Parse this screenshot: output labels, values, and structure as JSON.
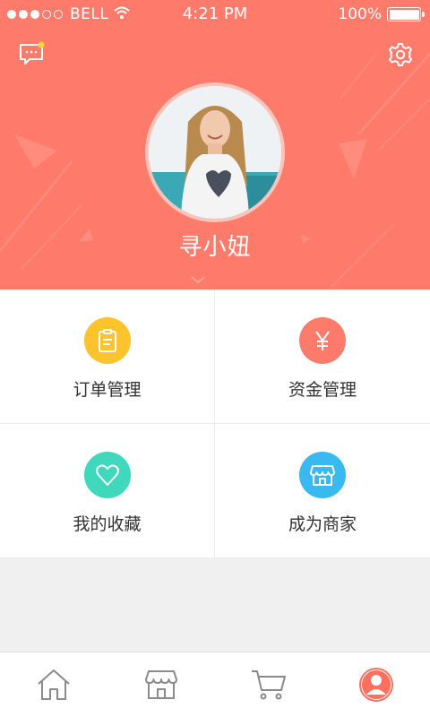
{
  "status_bar": {
    "carrier": "BELL",
    "time": "4:21 PM",
    "battery": "100%"
  },
  "profile": {
    "username": "寻小妞"
  },
  "menu": [
    {
      "label": "订单管理",
      "icon": "clipboard-icon",
      "color": "#fdc32c"
    },
    {
      "label": "资金管理",
      "icon": "yen-icon",
      "color": "#fe7b6b"
    },
    {
      "label": "我的收藏",
      "icon": "heart-icon",
      "color": "#3fd8bd"
    },
    {
      "label": "成为商家",
      "icon": "shop-icon",
      "color": "#38b9ef"
    }
  ],
  "tabs": [
    {
      "icon": "home-icon",
      "active": false
    },
    {
      "icon": "store-icon",
      "active": false
    },
    {
      "icon": "cart-icon",
      "active": false
    },
    {
      "icon": "profile-icon",
      "active": true
    }
  ],
  "colors": {
    "header_bg": "#fe7b6b",
    "active_tab": "#fe6f5e",
    "inactive_tab": "#8a8a8a"
  }
}
